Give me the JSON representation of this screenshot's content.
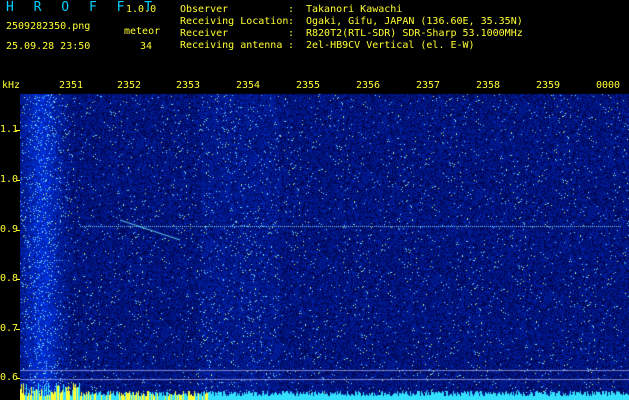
{
  "header": {
    "app_title": "H R O F F T",
    "version": "1.0.0",
    "filename": "2509282350.png",
    "meteor_label": "meteor",
    "datetime": "25.09.28 23:50",
    "meteor_count": "34",
    "info": [
      {
        "label": "Observer",
        "value": "Takanori Kawachi"
      },
      {
        "label": "Receiving Location",
        "value": "Ogaki, Gifu, JAPAN (136.60E, 35.35N)"
      },
      {
        "label": "Receiver",
        "value": "R820T2(RTL-SDR) SDR-Sharp 53.1000MHz"
      },
      {
        "label": "Receiving antenna",
        "value": "2el-HB9CV Vertical (el. E-W)"
      }
    ]
  },
  "time_axis": {
    "unit_label": "kHz",
    "ticks": [
      "2351",
      "2352",
      "2353",
      "2354",
      "2355",
      "2356",
      "2357",
      "2358",
      "2359",
      "0000"
    ]
  },
  "freq_axis": {
    "ticks": [
      "1.1",
      "1.0",
      "0.9",
      "0.8",
      "0.7",
      "0.6"
    ]
  },
  "colors": {
    "background": "#000000",
    "label_yellow": "#ffff33",
    "label_cyan": "#33ffff",
    "spectrogram_base": "#0a1a8a",
    "signal": "#8ff0ff"
  }
}
